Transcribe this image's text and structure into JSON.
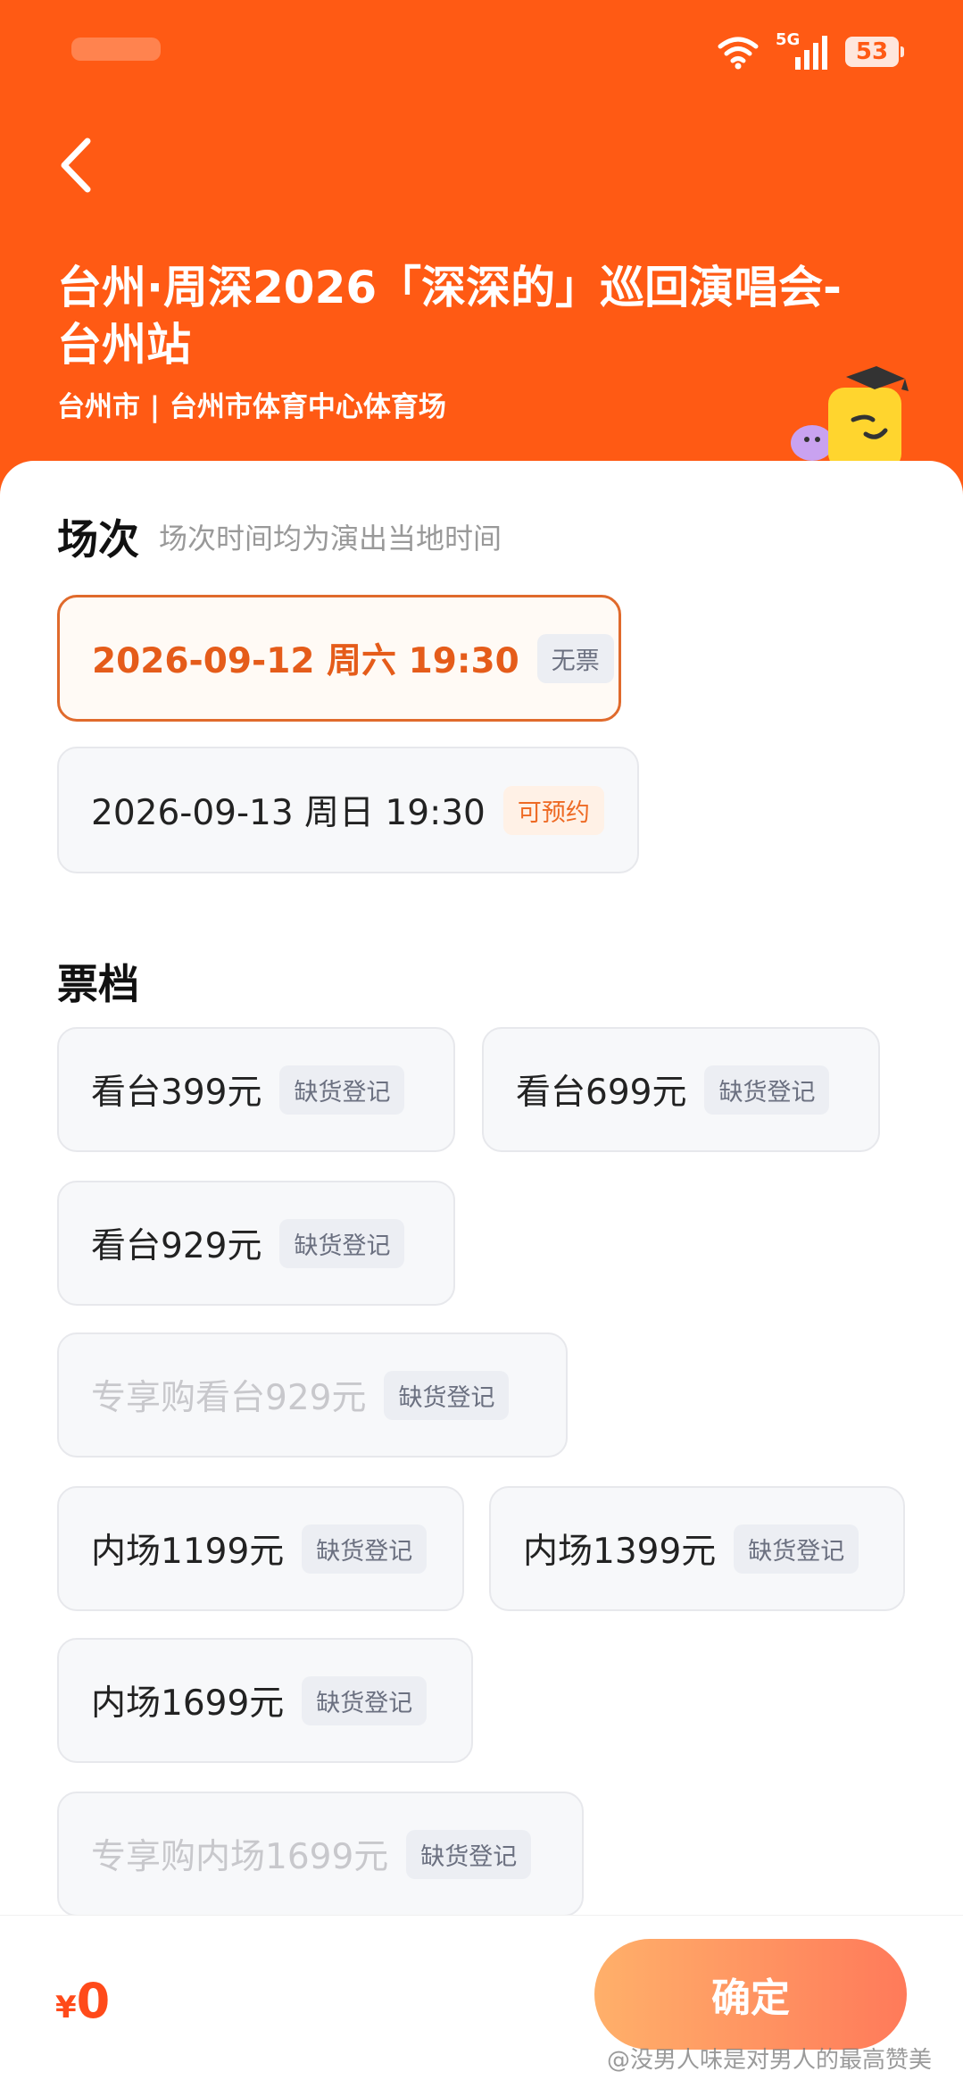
{
  "header": {
    "title": "台州·周深2026「深深的」巡回演唱会-台州站",
    "venue": "台州市 | 台州市体育中心体育场",
    "battery": "53",
    "network": "5G"
  },
  "sessions": {
    "title": "场次",
    "subtitle": "场次时间均为演出当地时间",
    "items": [
      {
        "label": "2026-09-12  周六 19:30",
        "tag": "无票",
        "selected": true
      },
      {
        "label": "2026-09-13 周日 19:30",
        "tag": "可预约",
        "selected": false
      }
    ]
  },
  "tickets": {
    "title": "票档",
    "items": [
      {
        "label": "看台399元",
        "tag": "缺货登记",
        "disabled": false
      },
      {
        "label": "看台699元",
        "tag": "缺货登记",
        "disabled": false
      },
      {
        "label": "看台929元",
        "tag": "缺货登记",
        "disabled": false
      },
      {
        "label": "专享购看台929元",
        "tag": "缺货登记",
        "disabled": true
      },
      {
        "label": "内场1199元",
        "tag": "缺货登记",
        "disabled": false
      },
      {
        "label": "内场1399元",
        "tag": "缺货登记",
        "disabled": false
      },
      {
        "label": "内场1699元",
        "tag": "缺货登记",
        "disabled": false
      },
      {
        "label": "专享购内场1699元",
        "tag": "缺货登记",
        "disabled": true
      }
    ]
  },
  "footer": {
    "currency": "¥",
    "amount": "0",
    "confirm_label": "确定"
  },
  "watermark": "@没男人味是对男人的最高赞美",
  "colors": {
    "brand": "#ff5a14",
    "selected_border": "#e06a2c",
    "price": "#ff4a1a"
  }
}
